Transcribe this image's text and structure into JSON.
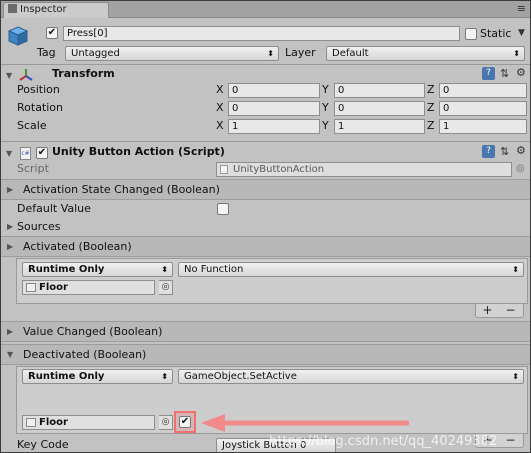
{
  "tab": {
    "title": "Inspector",
    "menu_glyph": "≡"
  },
  "gameobject": {
    "active": true,
    "name": "Press[0]",
    "static_label": "Static",
    "static_checked": false
  },
  "tag": {
    "label": "Tag",
    "value": "Untagged"
  },
  "layer": {
    "label": "Layer",
    "value": "Default"
  },
  "transform": {
    "title": "Transform",
    "rows": [
      {
        "label": "Position",
        "x": "0",
        "y": "0",
        "z": "0"
      },
      {
        "label": "Rotation",
        "x": "0",
        "y": "0",
        "z": "0"
      },
      {
        "label": "Scale",
        "x": "1",
        "y": "1",
        "z": "1"
      }
    ],
    "axis": {
      "x": "X",
      "y": "Y",
      "z": "Z"
    }
  },
  "script_component": {
    "title": "Unity Button Action (Script)",
    "enabled": true,
    "script_label": "Script",
    "script_value": "UnityButtonAction"
  },
  "activation_state_changed": "Activation State Changed (Boolean)",
  "default_value": {
    "label": "Default Value",
    "checked": false
  },
  "sources_label": "Sources",
  "activated": {
    "header": "Activated (Boolean)",
    "runtime": "Runtime Only",
    "function": "No Function",
    "object": "Floor"
  },
  "value_changed": "Value Changed (Boolean)",
  "deactivated": {
    "header": "Deactivated (Boolean)",
    "runtime": "Runtime Only",
    "function": "GameObject.SetActive",
    "object": "Floor",
    "param_checked": true
  },
  "list_buttons": {
    "add": "+",
    "remove": "−"
  },
  "key_code": {
    "label": "Key Code",
    "value": "Joystick Button 0"
  },
  "watermark": "https://blog.csdn.net/qq_40249382",
  "colors": {
    "arrow": "#f28a8a",
    "highlight": "#f07070"
  }
}
